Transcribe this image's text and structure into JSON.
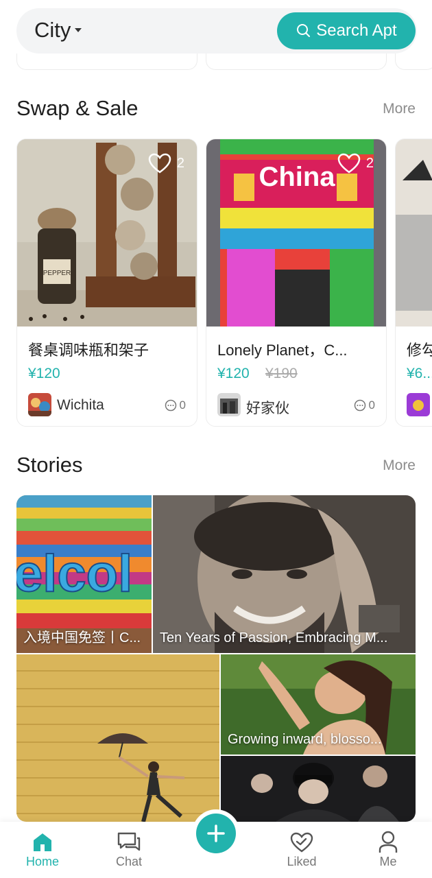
{
  "header": {
    "city_label": "City",
    "search_label": "Search Apt"
  },
  "swap": {
    "title": "Swap & Sale",
    "more": "More",
    "items": [
      {
        "title": "餐桌调味瓶和架子",
        "price": "¥120",
        "old_price": "",
        "likes": "2",
        "user": "Wichita",
        "comments": "0"
      },
      {
        "title": "Lonely Planet，C...",
        "price": "¥120",
        "old_price": "¥190",
        "likes": "2",
        "user": "好家伙",
        "comments": "0"
      },
      {
        "title": "修勾...",
        "price": "¥6...",
        "old_price": "",
        "likes": "",
        "user": "",
        "comments": ""
      }
    ],
    "image_texts": {
      "pepper": "PEPPER",
      "china": "China"
    }
  },
  "stories": {
    "title": "Stories",
    "more": "More",
    "items": [
      {
        "caption": "入境中国免签丨C..."
      },
      {
        "caption": "Ten Years of Passion, Embracing M..."
      },
      {
        "caption": ""
      },
      {
        "caption": "Growing inward, blosso..."
      },
      {
        "caption": ""
      }
    ]
  },
  "nav": {
    "home": "Home",
    "chat": "Chat",
    "liked": "Liked",
    "me": "Me"
  },
  "colors": {
    "accent": "#22b3ad",
    "muted": "#8c8c8c"
  }
}
